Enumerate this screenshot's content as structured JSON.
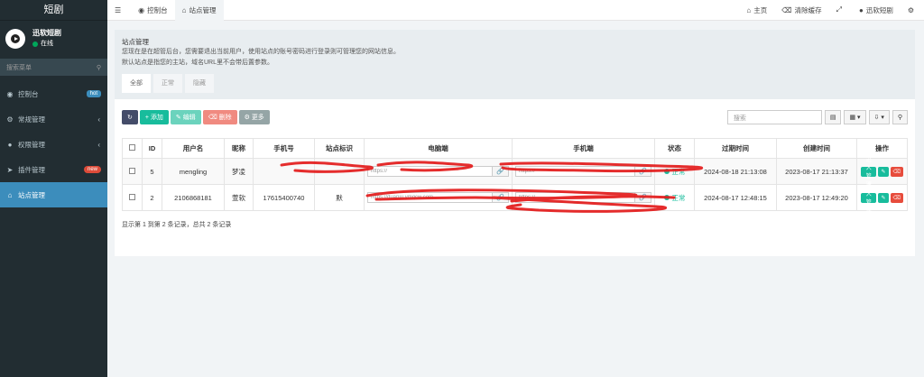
{
  "sidebar": {
    "logo": "短剧",
    "user": {
      "name": "迅软短剧",
      "status": "在线"
    },
    "search_placeholder": "搜索菜单",
    "items": [
      {
        "label": "控制台",
        "icon": "dashboard-icon",
        "badge": "hot"
      },
      {
        "label": "常规管理",
        "icon": "cogs-icon"
      },
      {
        "label": "权限管理",
        "icon": "group-icon"
      },
      {
        "label": "插件管理",
        "icon": "rocket-icon",
        "badge": "new"
      },
      {
        "label": "站点管理",
        "icon": "bank-icon"
      }
    ]
  },
  "topbar": {
    "tabs": [
      {
        "label": "控制台",
        "icon": "dashboard-icon"
      },
      {
        "label": "站点管理",
        "icon": "bank-icon"
      }
    ],
    "right": [
      "主页",
      "清除缓存",
      "迅软短剧"
    ]
  },
  "panel": {
    "title": "站点管理",
    "desc_1": "您现在是在超管后台，您需要退出当前用户，使用站点的账号密码进行登录则可管理您的网站信息。",
    "desc_2": "默认站点是指您的主站，域名URL里不会带后置参数。",
    "tabs": [
      "全部",
      "正常",
      "隐藏"
    ]
  },
  "toolbar": {
    "add": "添加",
    "edit": "编辑",
    "delete": "删除",
    "more": "更多",
    "search_placeholder": "搜索"
  },
  "table": {
    "headers": [
      "ID",
      "用户名",
      "昵称",
      "手机号",
      "站点标识",
      "电脑端",
      "手机端",
      "状态",
      "过期时间",
      "创建时间",
      "操作"
    ],
    "rows": [
      {
        "id": "5",
        "username": "mengling",
        "nickname": "梦凌",
        "phone": "",
        "sign": "",
        "pc_url": "https://",
        "mobile_url": "https://",
        "status": "正常",
        "expire": "2024-08-18 21:13:08",
        "created": "2023-08-17 21:13:37",
        "action": "进入管理"
      },
      {
        "id": "2",
        "username": "2106868181",
        "nickname": "萱软",
        "phone": "17615400740",
        "sign": "默",
        "pc_url": "https://duanju.ymqcw.com",
        "mobile_url": "https://",
        "status": "正常",
        "expire": "2024-08-17 12:48:15",
        "created": "2023-08-17 12:49:20",
        "action": "进入管理"
      }
    ],
    "footer": "显示第 1 到第 2 条记录，总共 2 条记录"
  },
  "colors": {
    "sidebar_bg": "#222d32",
    "active_blue": "#3c8dbc",
    "green": "#18bc9c",
    "red": "#e74c3c"
  }
}
